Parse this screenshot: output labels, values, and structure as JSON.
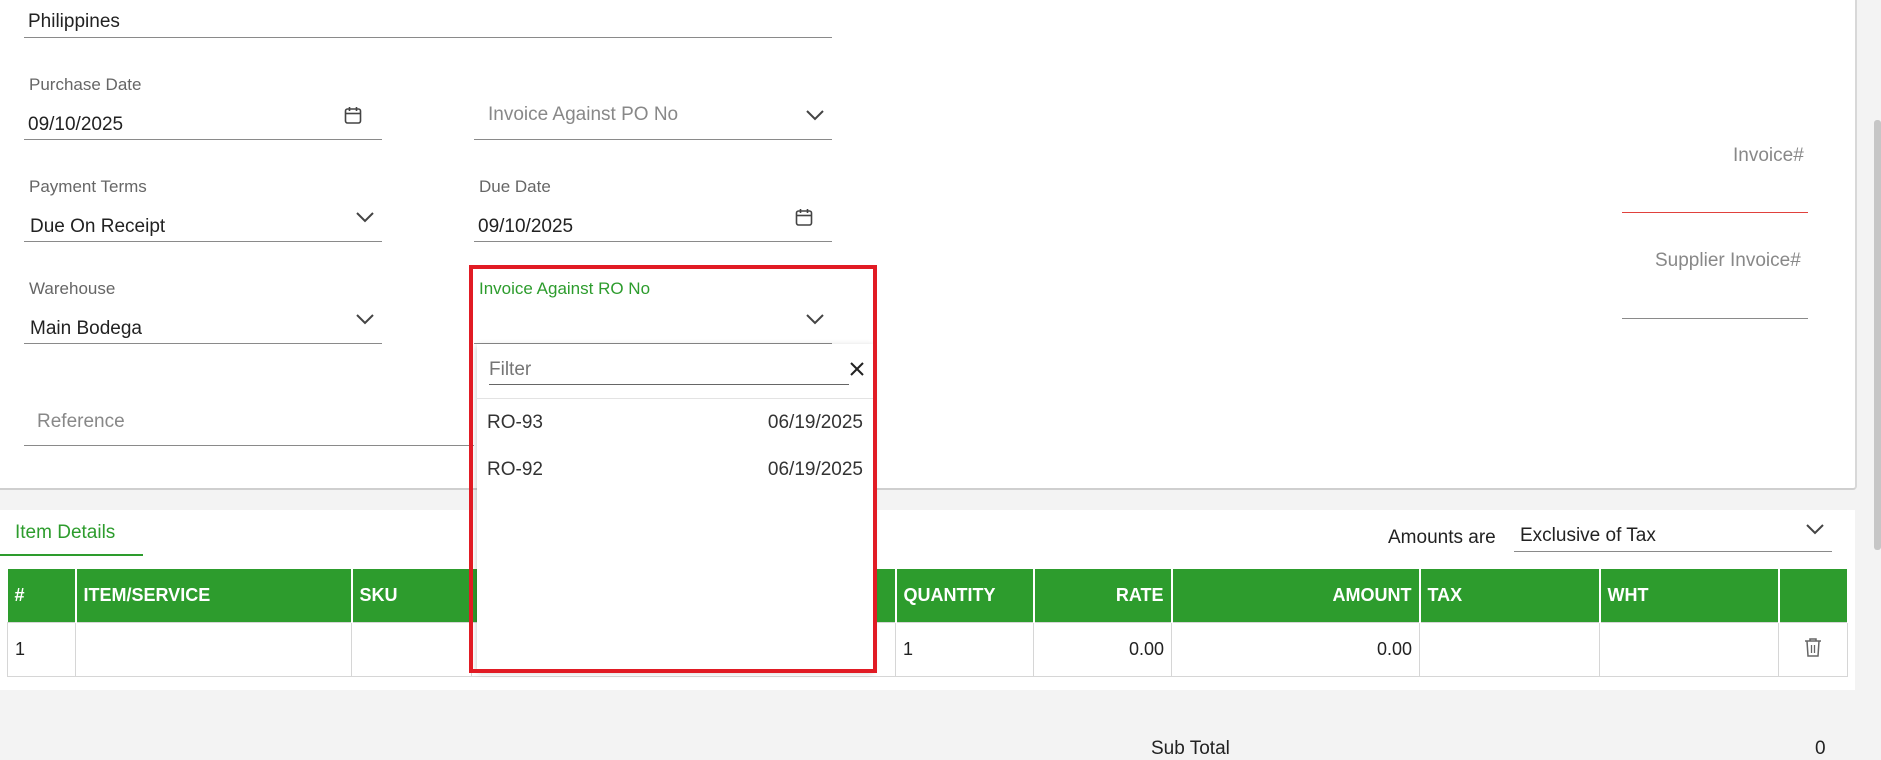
{
  "form": {
    "country_value": "Philippines",
    "purchase_date": {
      "label": "Purchase Date",
      "value": "09/10/2025"
    },
    "invoice_against_po": {
      "placeholder": "Invoice Against PO No"
    },
    "payment_terms": {
      "label": "Payment Terms",
      "value": "Due On Receipt"
    },
    "due_date": {
      "label": "Due Date",
      "value": "09/10/2025"
    },
    "warehouse": {
      "label": "Warehouse",
      "value": "Main Bodega"
    },
    "invoice_against_ro": {
      "label": "Invoice Against RO No",
      "value": ""
    },
    "reference": {
      "placeholder": "Reference"
    },
    "invoice_no": {
      "placeholder": "Invoice#"
    },
    "supplier_invoice_no": {
      "placeholder": "Supplier Invoice#"
    }
  },
  "dropdown": {
    "filter_placeholder": "Filter",
    "options": [
      {
        "code": "RO-93",
        "date": "06/19/2025"
      },
      {
        "code": "RO-92",
        "date": "06/19/2025"
      }
    ]
  },
  "tabs": {
    "active": "Item Details"
  },
  "amounts": {
    "label": "Amounts are",
    "value": "Exclusive of Tax"
  },
  "table": {
    "headers": [
      "#",
      "ITEM/SERVICE",
      "SKU",
      "",
      "QUANTITY",
      "RATE",
      "AMOUNT",
      "TAX",
      "WHT",
      ""
    ],
    "rows": [
      [
        "1",
        "",
        "",
        "",
        "1",
        "0.00",
        "0.00",
        "",
        "",
        ""
      ]
    ]
  },
  "footer": {
    "subtotal_label": "Sub Total",
    "subtotal_value": "0"
  },
  "colors": {
    "accent": "#2d9c2d",
    "highlight": "#e11b24",
    "invoice_line": "#e0413d"
  },
  "icons": [
    "calendar-icon",
    "chevron-down-icon",
    "close-icon",
    "trash-icon"
  ]
}
